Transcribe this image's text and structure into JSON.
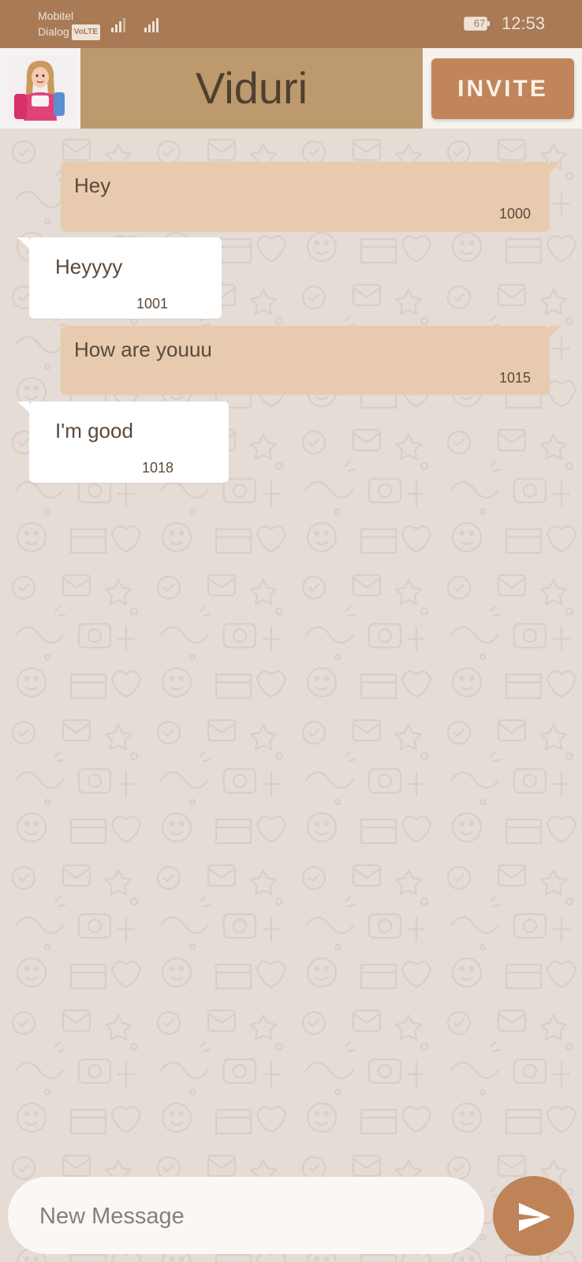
{
  "status_bar": {
    "carrier_1": "Mobitel",
    "carrier_2": "Dialog",
    "volte_badge": "VoLTE",
    "battery_level": "67",
    "time": "12:53"
  },
  "header": {
    "contact_name": "Viduri",
    "invite_label": "INVITE",
    "avatar_icon": "girl-photo-avatar"
  },
  "messages": [
    {
      "direction": "outgoing",
      "text": "Hey",
      "time": "1000"
    },
    {
      "direction": "incoming",
      "text": "Heyyyy",
      "time": "1001"
    },
    {
      "direction": "outgoing",
      "text": "How are youuu",
      "time": "1015"
    },
    {
      "direction": "incoming",
      "text": "I'm good",
      "time": "1018"
    }
  ],
  "composer": {
    "placeholder": "New Message",
    "value": "",
    "send_icon": "send-icon"
  },
  "colors": {
    "status_bar": "#a87a56",
    "title_bar": "#bd9a6d",
    "invite_button": "#c0855a",
    "outgoing_bubble": "#e8cbae",
    "incoming_bubble": "#ffffff",
    "chat_background": "#e4dcd5",
    "send_button": "#bf8358"
  }
}
